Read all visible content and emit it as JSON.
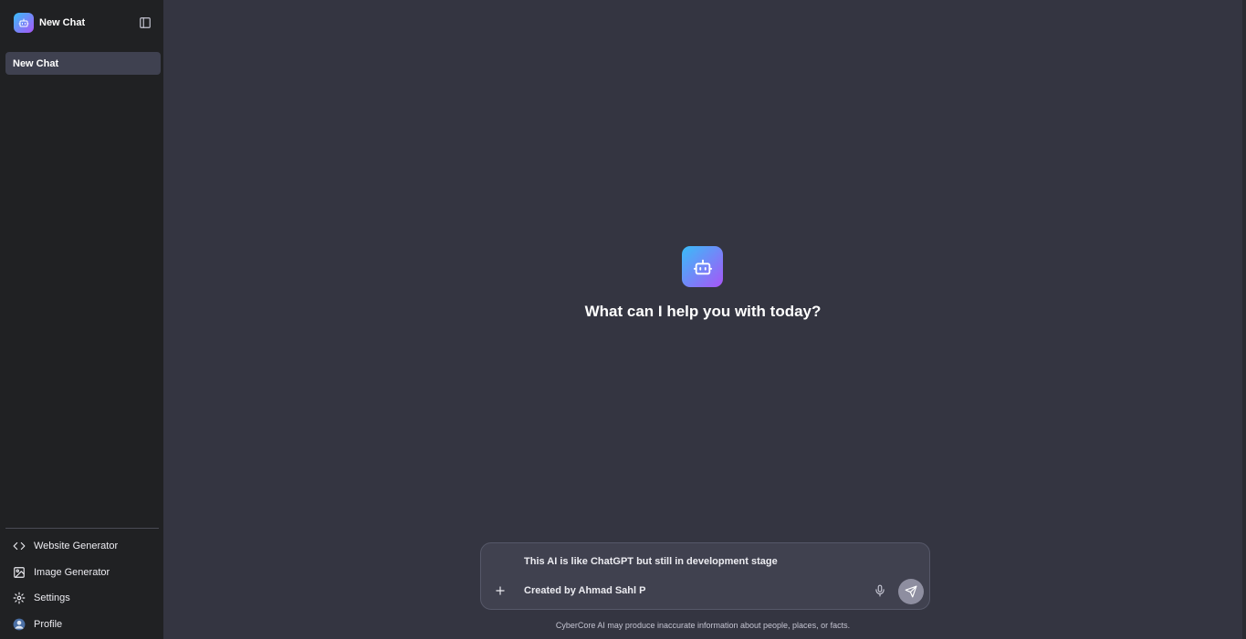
{
  "sidebar": {
    "header_title": "New Chat",
    "header_icon": "robot-icon",
    "toggle_icon": "sidebar-toggle-icon",
    "chats": [
      {
        "label": "New Chat"
      }
    ],
    "links": [
      {
        "label": "Website Generator",
        "icon": "code-icon"
      },
      {
        "label": "Image Generator",
        "icon": "image-icon"
      },
      {
        "label": "Settings",
        "icon": "gear-icon"
      },
      {
        "label": "Profile",
        "icon": "avatar"
      }
    ]
  },
  "main": {
    "hero_icon": "robot-icon",
    "hero_text": "What can I help you with today?",
    "composer": {
      "line1": "This AI is like ChatGPT but still in development stage",
      "line2": "Created by Ahmad Sahl P"
    },
    "disclaimer": "CyberCore AI may produce inaccurate information about people, places, or facts."
  },
  "colors": {
    "sidebar_bg": "#202123",
    "main_bg": "#343541",
    "composer_bg": "#40414f",
    "accent_gradient_start": "#38bdf8",
    "accent_gradient_end": "#a855f7"
  }
}
